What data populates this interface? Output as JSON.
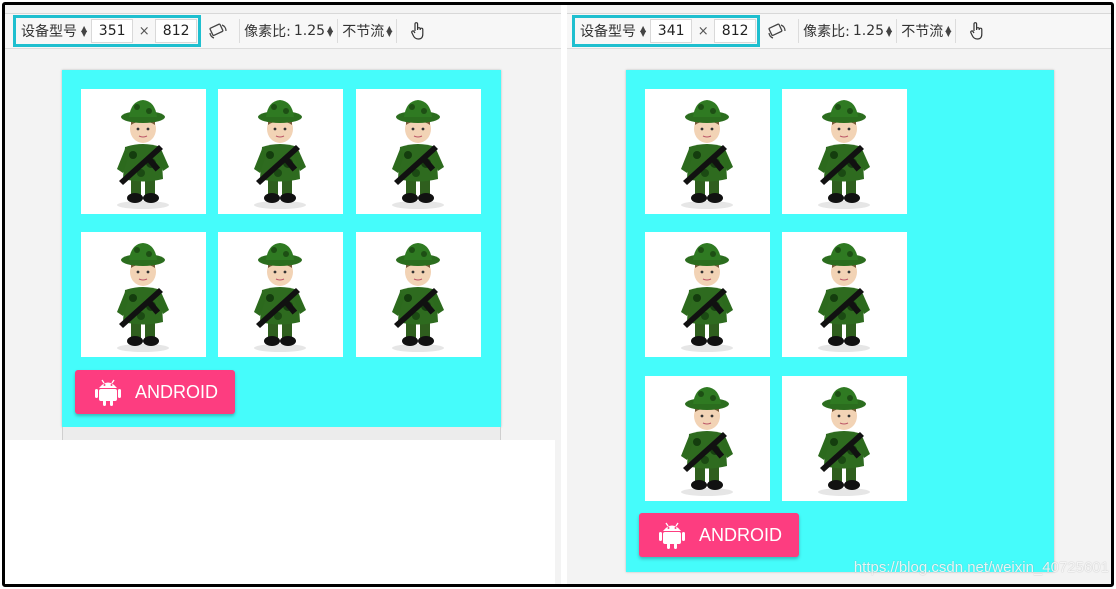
{
  "left": {
    "device_label": "设备型号",
    "width": "351",
    "times": "×",
    "height": "812",
    "dpr_label": "像素比:",
    "dpr_value": "1.25",
    "throttle": "不节流",
    "button_label": "ANDROID"
  },
  "right": {
    "device_label": "设备型号",
    "width": "341",
    "times": "×",
    "height": "812",
    "dpr_label": "像素比:",
    "dpr_value": "1.25",
    "throttle": "不节流",
    "button_label": "ANDROID"
  },
  "watermark": "https://blog.csdn.net/weixin_40725601",
  "colors": {
    "page_bg": "#45fcfb",
    "button": "#fd3d80",
    "highlight": "#1fbfcf"
  },
  "icons": [
    "rotate-device-icon",
    "touch-hand-icon",
    "android-icon",
    "soldier-figure-image"
  ]
}
